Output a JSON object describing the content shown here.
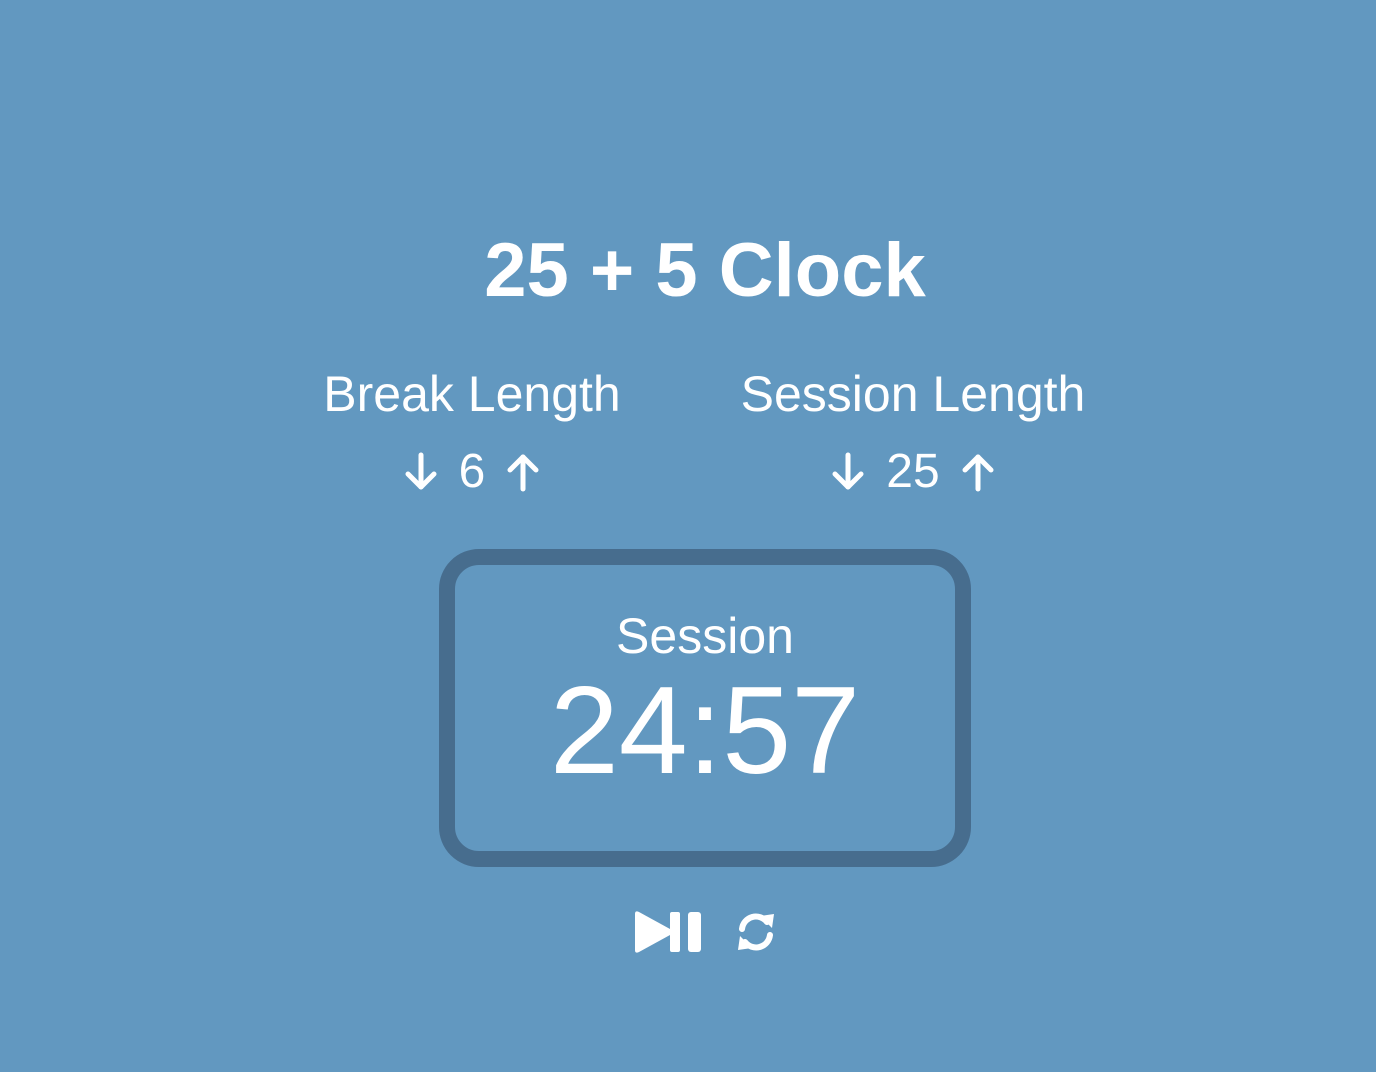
{
  "app": {
    "title": "25 + 5 Clock",
    "background_color": "#6298c0",
    "timer_border_color": "#476d8e"
  },
  "break": {
    "label": "Break Length",
    "value": "6",
    "decrement_icon": "arrow-down-icon",
    "increment_icon": "arrow-up-icon"
  },
  "session": {
    "label": "Session Length",
    "value": "25",
    "decrement_icon": "arrow-down-icon",
    "increment_icon": "arrow-up-icon"
  },
  "timer": {
    "label": "Session",
    "time_left": "24:57"
  },
  "controls": {
    "start_stop_icon": "play-pause-icon",
    "reset_icon": "refresh-icon"
  }
}
